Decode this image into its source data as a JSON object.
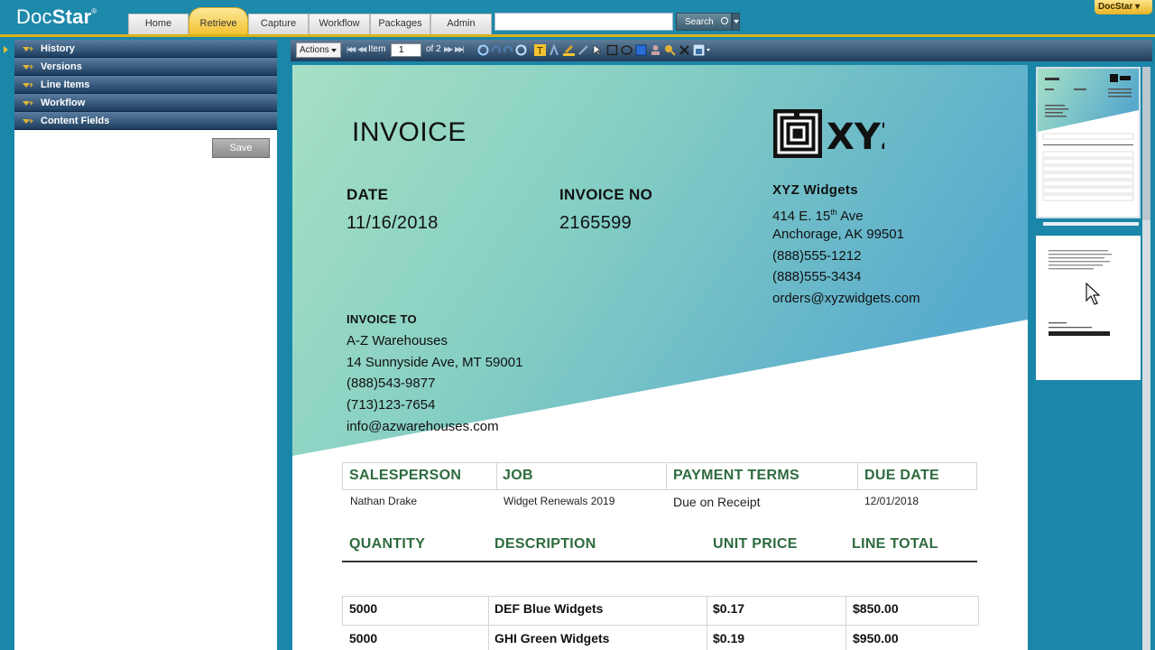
{
  "app": {
    "logo_text": "Doc",
    "logo_bold": "Star",
    "logo_mark": "®",
    "user_menu": "DocStar ▾"
  },
  "nav": {
    "tabs": [
      "Home",
      "Retrieve",
      "Capture",
      "Workflow",
      "Packages",
      "Admin"
    ],
    "active": "Retrieve"
  },
  "search": {
    "value": "",
    "button_label": "Search"
  },
  "sidebar": {
    "sections": [
      "History",
      "Versions",
      "Line Items",
      "Workflow",
      "Content Fields"
    ],
    "save_label": "Save"
  },
  "toolbar": {
    "actions_label": "Actions",
    "item_label": "Item",
    "item_value": "1",
    "of_label": "of 2"
  },
  "document": {
    "title": "INVOICE",
    "logo_text": "XYZ",
    "date_label": "DATE",
    "date_value": "11/16/2018",
    "invoice_no_label": "INVOICE NO",
    "invoice_no_value": "2165599",
    "company": {
      "name": "XYZ Widgets",
      "street_prefix": "414 E. 15",
      "street_sup": "th",
      "street_suffix": " Ave",
      "city": "Anchorage, AK 99501",
      "phone1": "(888)555-1212",
      "phone2": "(888)555-3434",
      "email": "orders@xyzwidgets.com"
    },
    "invoice_to": {
      "label": "INVOICE TO",
      "name": "A-Z Warehouses",
      "street": "14 Sunnyside Ave, MT 59001",
      "phone1": "(888)543-9877",
      "phone2": "(713)123-7654",
      "email": "info@azwarehouses.com"
    },
    "meta_table": {
      "headers": [
        "SALESPERSON",
        "JOB",
        "PAYMENT TERMS",
        "DUE DATE"
      ],
      "values": [
        "Nathan Drake",
        "Widget Renewals 2019",
        "Due on Receipt",
        "12/01/2018"
      ]
    },
    "items_table": {
      "headers": [
        "QUANTITY",
        "DESCRIPTION",
        "UNIT PRICE",
        "LINE TOTAL"
      ],
      "rows": [
        [
          "5000",
          "DEF Blue Widgets",
          "$0.17",
          "$850.00"
        ],
        [
          "5000",
          "GHI Green Widgets",
          "$0.19",
          "$950.00"
        ]
      ]
    }
  },
  "colors": {
    "frame": "#1a86a8",
    "accent_gold": "#d9b21a",
    "table_green": "#2e6b3f",
    "gradient_start": "#9ddcc2",
    "gradient_end": "#54abcb"
  }
}
